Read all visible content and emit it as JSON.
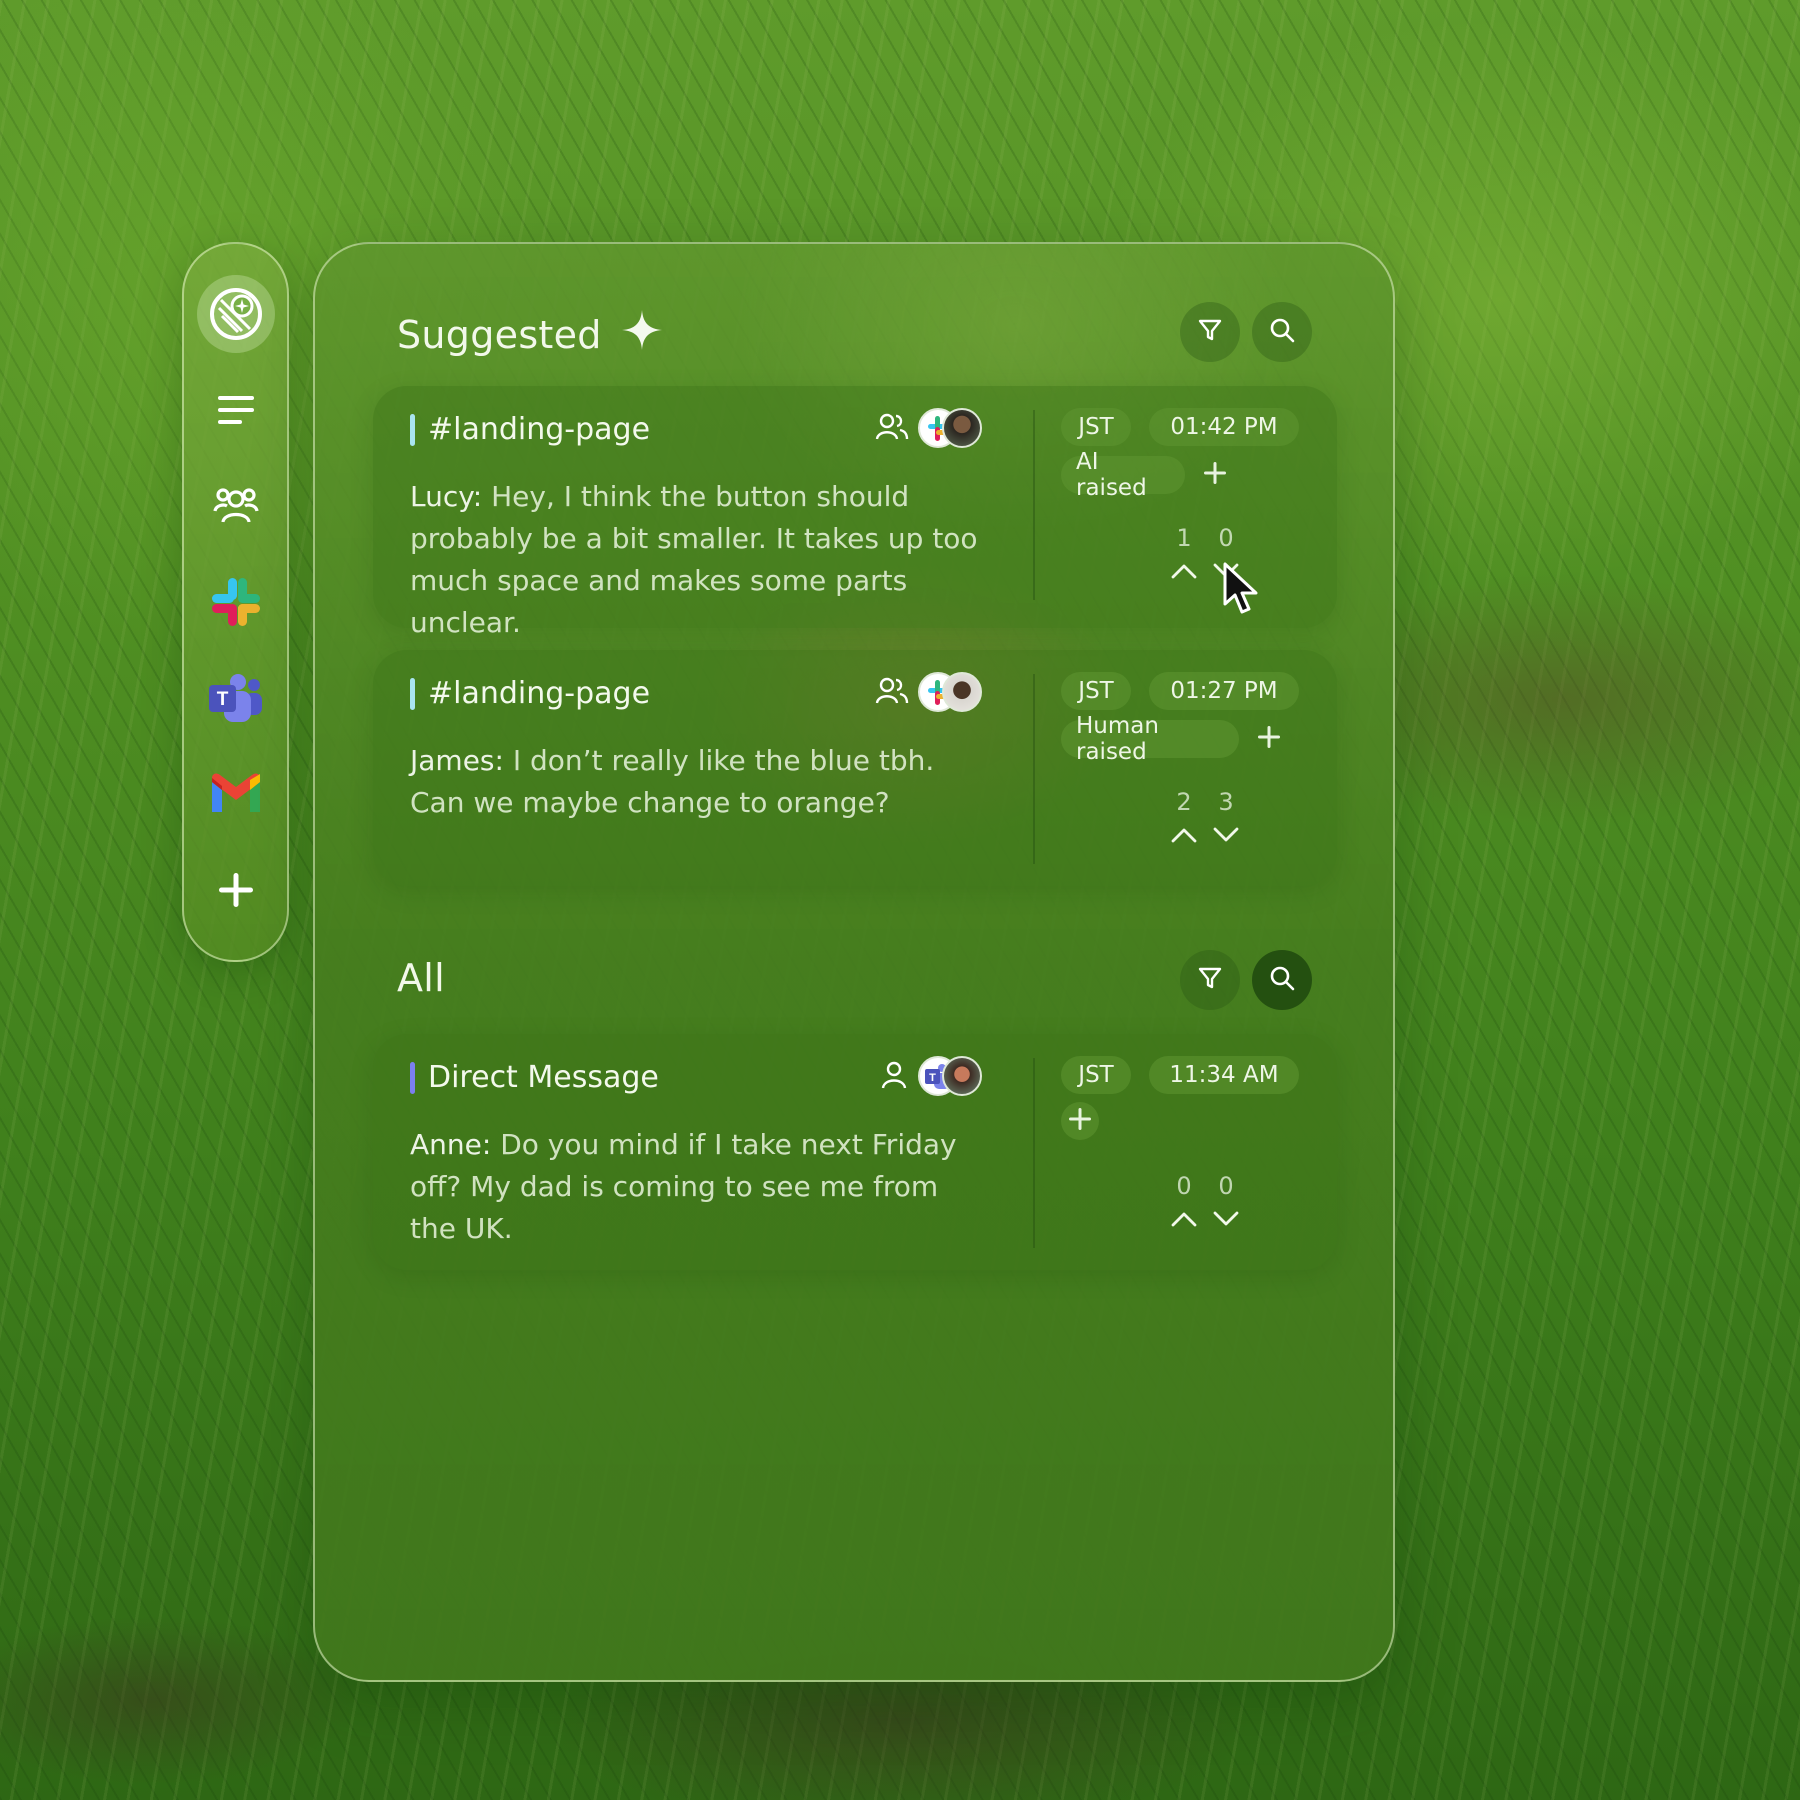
{
  "sidebar": {
    "items": [
      {
        "name": "logo",
        "icon": "compass-logo-icon"
      },
      {
        "name": "feed",
        "icon": "lines-icon"
      },
      {
        "name": "team",
        "icon": "people-icon"
      },
      {
        "name": "slack",
        "icon": "slack-icon"
      },
      {
        "name": "teams",
        "icon": "teams-icon"
      },
      {
        "name": "gmail",
        "icon": "gmail-icon"
      },
      {
        "name": "add",
        "icon": "plus-icon"
      }
    ]
  },
  "suggested": {
    "title": "Suggested",
    "cards": [
      {
        "channel": "#landing-page",
        "author": "Lucy:",
        "message": " Hey, I think the button should probably be a bit smaller. It takes up too much space and makes some parts unclear.",
        "timezone": "JST",
        "time": "01:42 PM",
        "tag": "AI raised",
        "upvotes": "1",
        "downvotes": "0"
      },
      {
        "channel": "#landing-page",
        "author": "James:",
        "message": " I don’t really like the blue tbh. Can we maybe change to orange?",
        "timezone": "JST",
        "time": "01:27 PM",
        "tag": "Human raised",
        "upvotes": "2",
        "downvotes": "3"
      }
    ]
  },
  "all": {
    "title": "All",
    "cards": [
      {
        "channel": "Direct Message",
        "author": "Anne:",
        "message": " Do you mind if I take next Friday off? My dad is coming to see me from the UK.",
        "timezone": "JST",
        "time": "11:34 AM",
        "upvotes": "0",
        "downvotes": "0"
      }
    ]
  },
  "colors": {
    "channel_accent": "#a9e4f0",
    "dm_accent": "#7b7ff0",
    "panel_green": "#5f9630"
  }
}
